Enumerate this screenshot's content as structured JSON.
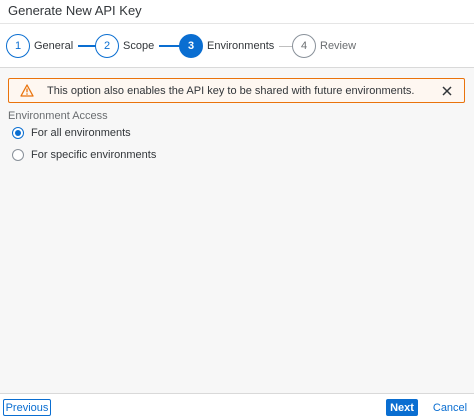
{
  "dialog": {
    "title": "Generate New API Key"
  },
  "wizard": {
    "steps": [
      {
        "number": "1",
        "label": "General",
        "state": "completed"
      },
      {
        "number": "2",
        "label": "Scope",
        "state": "completed"
      },
      {
        "number": "3",
        "label": "Environments",
        "state": "current"
      },
      {
        "number": "4",
        "label": "Review",
        "state": "upcoming"
      }
    ]
  },
  "warning": {
    "icon": "warning-icon",
    "text": "This option also enables the API key to be shared with future environments.",
    "close_icon": "close-icon"
  },
  "environment_access": {
    "label": "Environment Access",
    "options": [
      {
        "label": "For all environments",
        "selected": true
      },
      {
        "label": "For specific environments",
        "selected": false
      }
    ]
  },
  "footer": {
    "previous_label": "Previous",
    "next_label": "Next",
    "cancel_label": "Cancel"
  },
  "colors": {
    "accent": "#0a6ed1",
    "warning_border": "#e9730c",
    "warning_background": "#fef7f1"
  }
}
